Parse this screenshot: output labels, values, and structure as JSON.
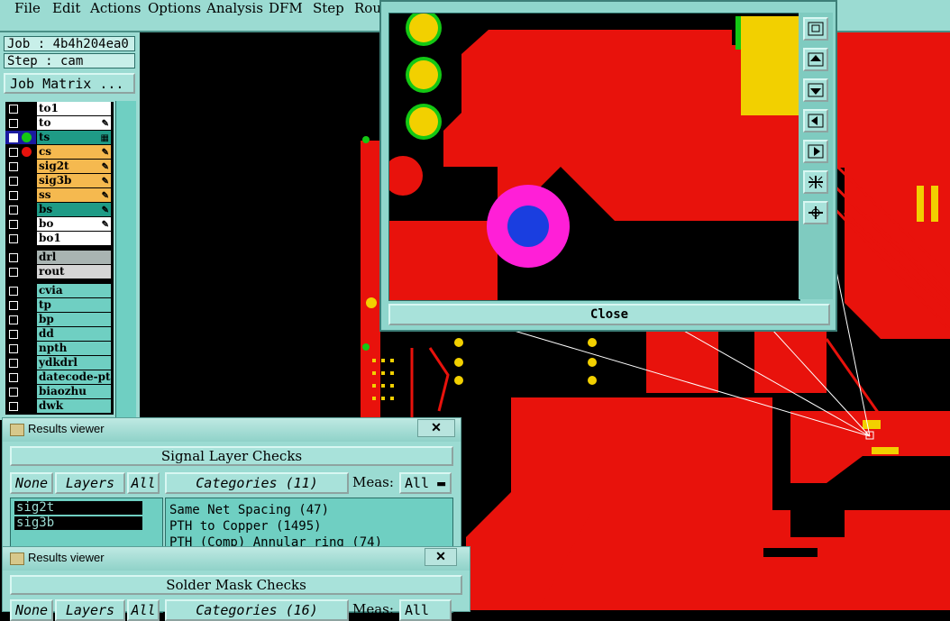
{
  "menubar": [
    "File",
    "Edit",
    "Actions",
    "Options",
    "Analysis",
    "DFM",
    "Step",
    "Rout"
  ],
  "job": {
    "label": "Job : 4b4h204ea0",
    "step": "Step : cam",
    "matrix_button": "Job Matrix ..."
  },
  "layers": [
    {
      "name": "to1",
      "color": "#ffffff",
      "mark": ""
    },
    {
      "name": "to",
      "color": "#ffffff",
      "mark": "✎"
    },
    {
      "name": "ts",
      "color": "#1f9b86",
      "mark": "▦"
    },
    {
      "name": "cs",
      "color": "#f5b94f",
      "mark": "✎"
    },
    {
      "name": "sig2t",
      "color": "#f5b94f",
      "mark": "✎"
    },
    {
      "name": "sig3b",
      "color": "#f5b94f",
      "mark": "✎"
    },
    {
      "name": "ss",
      "color": "#f5b94f",
      "mark": "✎"
    },
    {
      "name": "bs",
      "color": "#1f9b86",
      "mark": "✎"
    },
    {
      "name": "bo",
      "color": "#ffffff",
      "mark": "✎"
    },
    {
      "name": "bo1",
      "color": "#ffffff",
      "mark": ""
    },
    {
      "name": "drl",
      "color": "#a9b4b2",
      "mark": ""
    },
    {
      "name": "rout",
      "color": "#d6d6d6",
      "mark": ""
    },
    {
      "name": "cvia",
      "color": "#6fcfc2",
      "mark": ""
    },
    {
      "name": "tp",
      "color": "#6fcfc2",
      "mark": ""
    },
    {
      "name": "bp",
      "color": "#6fcfc2",
      "mark": ""
    },
    {
      "name": "dd",
      "color": "#6fcfc2",
      "mark": ""
    },
    {
      "name": "npth",
      "color": "#6fcfc2",
      "mark": ""
    },
    {
      "name": "ydkdrl",
      "color": "#6fcfc2",
      "mark": ""
    },
    {
      "name": "datecode-ptc",
      "color": "#6fcfc2",
      "mark": ""
    },
    {
      "name": "biaozhu",
      "color": "#6fcfc2",
      "mark": ""
    },
    {
      "name": "dwk",
      "color": "#6fcfc2",
      "mark": ""
    }
  ],
  "zoom_window": {
    "close_label": "Close"
  },
  "results1": {
    "title": "Results viewer",
    "close": "✕",
    "header": "Signal Layer Checks",
    "none": "None",
    "layers": "Layers",
    "all": "All",
    "categories": "Categories (11)",
    "meas_label": "Meas:",
    "meas_value": "All",
    "selected_layers": [
      "sig2t",
      "sig3b"
    ],
    "category_items": [
      "Same Net Spacing (47)",
      "PTH to Copper (1495)",
      "PTH (Comp) Annular ring (74)"
    ]
  },
  "results2": {
    "title": "Results viewer",
    "close": "✕",
    "header": "Solder Mask Checks",
    "none": "None",
    "layers": "Layers",
    "all": "All",
    "categories": "Categories (16)",
    "meas_label": "Meas:",
    "meas_value": "All"
  }
}
